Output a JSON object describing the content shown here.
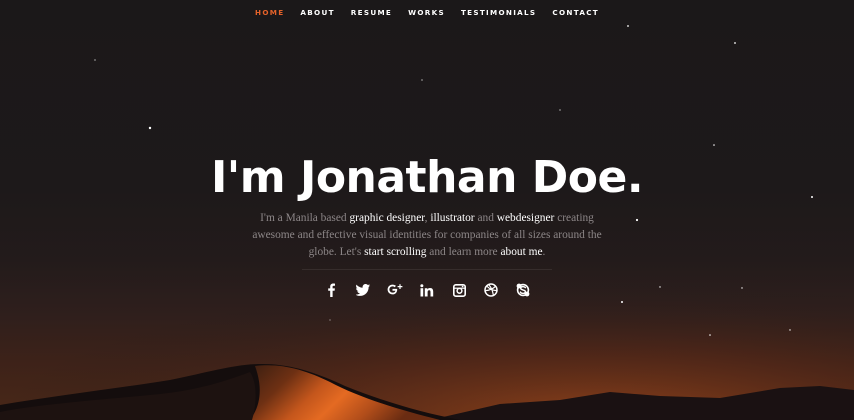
{
  "nav": {
    "items": [
      {
        "label": "HOME",
        "active": true
      },
      {
        "label": "ABOUT",
        "active": false
      },
      {
        "label": "RESUME",
        "active": false
      },
      {
        "label": "WORKS",
        "active": false
      },
      {
        "label": "TESTIMONIALS",
        "active": false
      },
      {
        "label": "CONTACT",
        "active": false
      }
    ],
    "active_color": "#e4622a"
  },
  "hero": {
    "title": "I'm Jonathan Doe.",
    "intro": {
      "t1": "I'm a Manila based ",
      "l1": "graphic designer",
      "t2": ", ",
      "l2": "illustrator",
      "t3": " and ",
      "l3": "webdesigner",
      "t4": " creating awesome and effective visual identities for companies of all sizes around the globe. Let's ",
      "l4": "start scrolling",
      "t5": " and learn more ",
      "l5": "about me",
      "t6": "."
    }
  },
  "social": [
    {
      "icon": "facebook-icon"
    },
    {
      "icon": "twitter-icon"
    },
    {
      "icon": "google-plus-icon"
    },
    {
      "icon": "linkedin-icon"
    },
    {
      "icon": "instagram-icon"
    },
    {
      "icon": "dribbble-icon"
    },
    {
      "icon": "skype-icon"
    }
  ],
  "colors": {
    "background": "#1b1819",
    "dune": "#d9601e",
    "text_muted": "#8c8687",
    "text_highlight": "#ffffff"
  }
}
